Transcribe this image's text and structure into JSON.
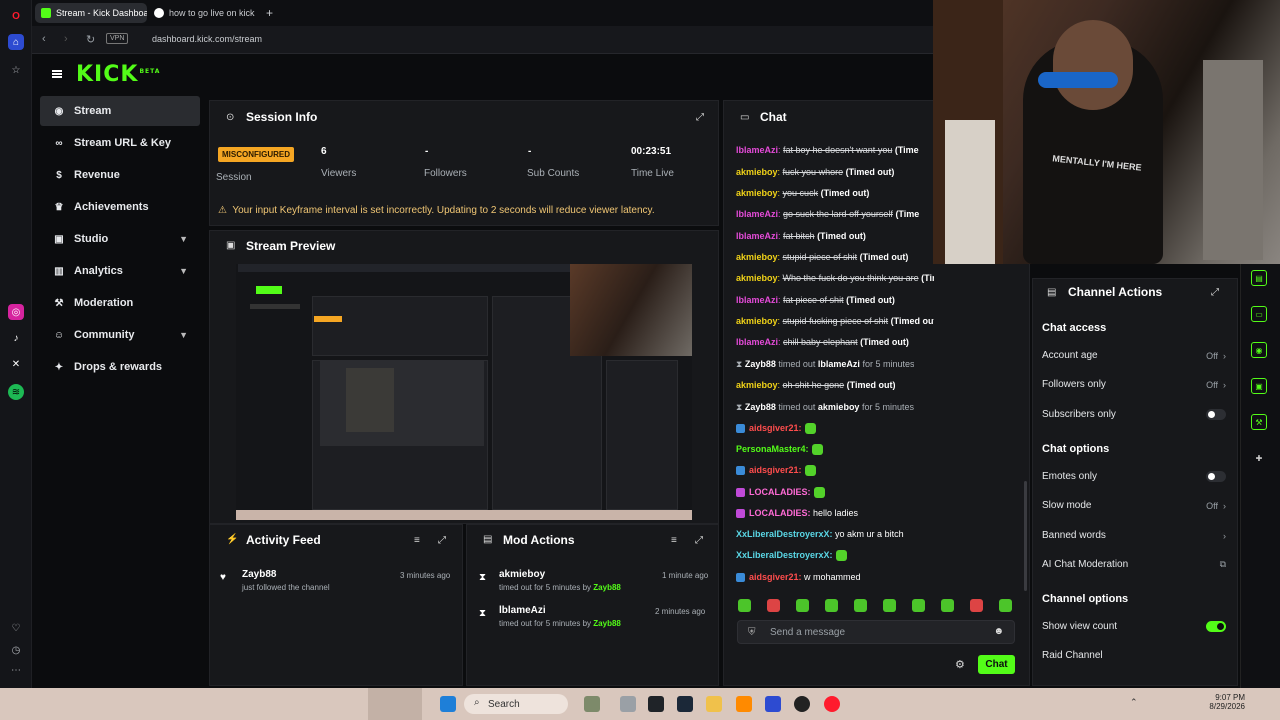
{
  "browser": {
    "tabs": [
      {
        "label": "Stream - Kick Dashboard",
        "active": true
      },
      {
        "label": "how to go live on kick - Go",
        "active": false
      }
    ],
    "new_tab": "+",
    "vpn_label": "VPN",
    "url": "dashboard.kick.com/stream",
    "rail_icons": [
      "opera-icon",
      "home-icon",
      "star-icon",
      "instagram-icon",
      "tiktok-icon",
      "x-icon",
      "spotify-icon",
      "heart-icon",
      "history-icon",
      "more-icon"
    ]
  },
  "header": {
    "logo": "KICK",
    "beta": "BETA"
  },
  "sidebar": {
    "items": [
      {
        "label": "Stream",
        "icon": "radio-icon",
        "active": true
      },
      {
        "label": "Stream URL & Key",
        "icon": "link-icon"
      },
      {
        "label": "Revenue",
        "icon": "dollar-icon"
      },
      {
        "label": "Achievements",
        "icon": "trophy-icon"
      },
      {
        "label": "Studio",
        "icon": "camera-icon",
        "expandable": true
      },
      {
        "label": "Analytics",
        "icon": "chart-icon",
        "expandable": true
      },
      {
        "label": "Moderation",
        "icon": "hammer-icon"
      },
      {
        "label": "Community",
        "icon": "people-icon",
        "expandable": true
      },
      {
        "label": "Drops & rewards",
        "icon": "gift-icon"
      }
    ]
  },
  "session": {
    "title": "Session Info",
    "status_badge": "MISCONFIGURED",
    "session_label": "Session",
    "stats": [
      {
        "value": "6",
        "label": "Viewers"
      },
      {
        "value": "-",
        "label": "Followers"
      },
      {
        "value": "-",
        "label": "Sub Counts"
      },
      {
        "value": "00:23:51",
        "label": "Time Live"
      }
    ],
    "warning": "Your input Keyframe interval is set incorrectly. Updating to 2 seconds will reduce viewer latency."
  },
  "preview": {
    "title": "Stream Preview"
  },
  "activity": {
    "title": "Activity Feed",
    "items": [
      {
        "name": "Zayb88",
        "text": "just followed the channel",
        "time": "3 minutes ago"
      }
    ]
  },
  "mod_actions": {
    "title": "Mod Actions",
    "items": [
      {
        "name": "akmieboy",
        "prefix": "timed out for 5 minutes by",
        "by": "Zayb88",
        "time": "1 minute ago"
      },
      {
        "name": "lblameAzi",
        "prefix": "timed out for 5 minutes by",
        "by": "Zayb88",
        "time": "2 minutes ago"
      }
    ]
  },
  "chat": {
    "title": "Chat",
    "messages": [
      {
        "user": "lblameAzi",
        "color": "#e44bd8",
        "text": "fat boy he doesn't want you",
        "suffix": "(Time",
        "struck": true
      },
      {
        "user": "akmieboy",
        "color": "#f0d218",
        "text": "fuck you whore",
        "suffix": "(Timed out)",
        "struck": true
      },
      {
        "user": "akmieboy",
        "color": "#f0d218",
        "text": "you cuck",
        "suffix": "(Timed out)",
        "struck": true
      },
      {
        "user": "lblameAzi",
        "color": "#e44bd8",
        "text": "go suck the lard off yourself",
        "suffix": "(Time",
        "struck": true
      },
      {
        "user": "lblameAzi",
        "color": "#e44bd8",
        "text": "fat bitch",
        "suffix": "(Timed out)",
        "struck": true
      },
      {
        "user": "akmieboy",
        "color": "#f0d218",
        "text": "stupid piece of shit",
        "suffix": "(Timed out)",
        "struck": true
      },
      {
        "user": "akmieboy",
        "color": "#f0d218",
        "text": "Who the fuck do you think you are",
        "suffix": "(Timed out)",
        "struck": true
      },
      {
        "user": "lblameAzi",
        "color": "#e44bd8",
        "text": "fat piece of shit",
        "suffix": "(Timed out)",
        "struck": true
      },
      {
        "user": "akmieboy",
        "color": "#f0d218",
        "text": "stupid fucking piece of shit",
        "suffix": "(Timed out)",
        "struck": true
      },
      {
        "user": "lblameAzi",
        "color": "#e44bd8",
        "text": "chill baby elephant",
        "suffix": "(Timed out)",
        "struck": true
      }
    ],
    "system1": {
      "actor": "Zayb88",
      "middle": "timed out",
      "target": "lblameAzi",
      "tail": "for 5 minutes"
    },
    "msg_after1": {
      "user": "akmieboy",
      "color": "#f0d218",
      "text": "oh shit he gone",
      "suffix": "(Timed out)"
    },
    "system2": {
      "actor": "Zayb88",
      "middle": "timed out",
      "target": "akmieboy",
      "tail": "for 5 minutes"
    },
    "later": [
      {
        "user": "aidsgiver21:",
        "color": "#ff4d4d",
        "text": "",
        "emote": true,
        "badge": true
      },
      {
        "user": "PersonaMaster4:",
        "color": "#53fc18",
        "text": "",
        "emote": true,
        "badge": false
      },
      {
        "user": "aidsgiver21:",
        "color": "#ff4d4d",
        "text": "",
        "emote": true,
        "badge": true
      },
      {
        "user": "LOCALADIES:",
        "color": "#ff6bd6",
        "text": "",
        "emote": true,
        "badge": true
      },
      {
        "user": "LOCALADIES:",
        "color": "#ff6bd6",
        "text": "hello ladies",
        "emote": false,
        "badge": true
      },
      {
        "user": "XxLiberalDestroyerxX:",
        "color": "#5ad7e6",
        "text": "yo akm ur a bitch",
        "emote": false,
        "badge": false
      },
      {
        "user": "XxLiberalDestroyerxX:",
        "color": "#5ad7e6",
        "text": "",
        "emote": true,
        "badge": false
      },
      {
        "user": "aidsgiver21:",
        "color": "#ff4d4d",
        "text": "w mohammed",
        "emote": false,
        "badge": true
      }
    ],
    "input_placeholder": "Send a message",
    "send_label": "Chat"
  },
  "channel_actions": {
    "title": "Channel Actions",
    "chat_access": {
      "heading": "Chat access",
      "account_age": "Account age",
      "account_age_val": "Off",
      "followers_only": "Followers only",
      "followers_only_val": "Off",
      "subscribers_only": "Subscribers only"
    },
    "chat_options": {
      "heading": "Chat options",
      "emotes_only": "Emotes only",
      "slow_mode": "Slow mode",
      "slow_mode_val": "Off",
      "banned_words": "Banned words",
      "ai_moderation": "AI Chat Moderation"
    },
    "channel_options": {
      "heading": "Channel options",
      "show_view_count": "Show view count",
      "raid_channel": "Raid Channel"
    }
  },
  "webcam": {
    "shirt_text": "MENTALLY I'M HERE"
  },
  "taskbar": {
    "search": "Search",
    "time": "9:07 PM",
    "date": "8/29/2026"
  },
  "colors": {
    "accent": "#53fc18",
    "warning": "#f5a623",
    "panel": "#17181b"
  }
}
